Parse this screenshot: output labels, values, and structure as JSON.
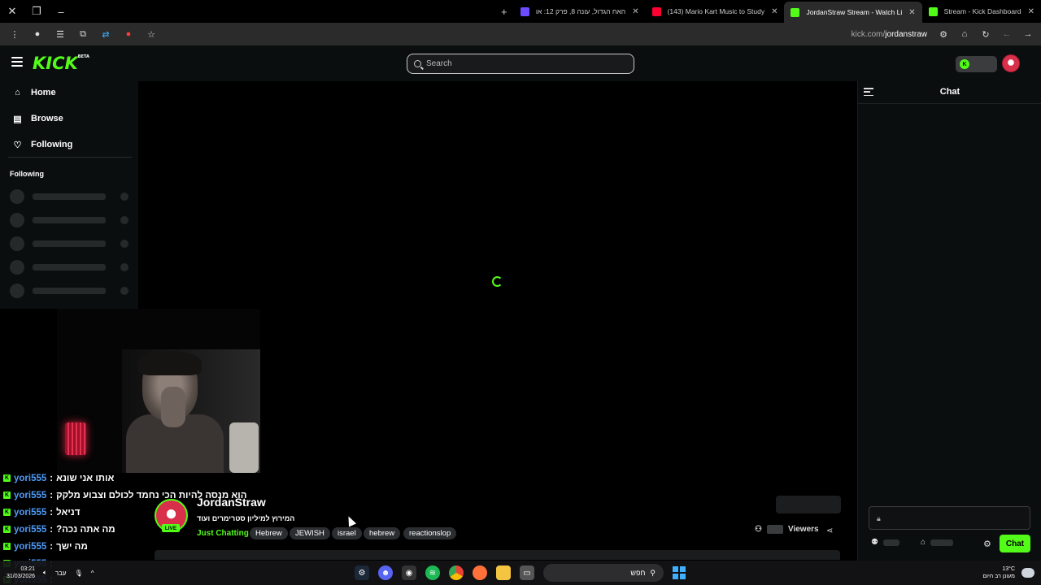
{
  "browser": {
    "tabs": [
      {
        "title": "Stream - Kick Dashboard",
        "fav_color": "#53fc18",
        "active": false
      },
      {
        "title": "JordanStraw Stream - Watch Li",
        "fav_color": "#53fc18",
        "active": true
      },
      {
        "title": "(143) Mario Kart Music to Study",
        "fav_color": "#ff0033",
        "active": false
      },
      {
        "title": "האח הגדול, עונה 8, פרק 12: או",
        "fav_color": "#6b4cff",
        "active": false
      }
    ],
    "url_host": "kick.com/",
    "url_path": "jordanstraw"
  },
  "header": {
    "logo": "KICK",
    "logo_badge": "BETA",
    "search_placeholder": "Search"
  },
  "sidebar": {
    "nav": [
      {
        "label": "Home",
        "icon": "home-icon"
      },
      {
        "label": "Browse",
        "icon": "browse-icon"
      },
      {
        "label": "Following",
        "icon": "heart-icon"
      }
    ],
    "following_heading": "Following"
  },
  "chat_overlay": [
    {
      "user": "yori555",
      "text": "אותו אני שונא"
    },
    {
      "user": "yori555",
      "text": "הוא מנסה להיות הכי נחמד לכולם וצבוע מלקק"
    },
    {
      "user": "yori555",
      "text": "דניאל"
    },
    {
      "user": "yori555",
      "text": "?מה אתה נכה"
    },
    {
      "user": "yori555",
      "text": "מה ישך"
    },
    {
      "user": "yori555",
      "text": ""
    },
    {
      "user": "yori555",
      "text": ""
    }
  ],
  "stream": {
    "channel": "JordanStraw",
    "title": "המירוץ למיליון סטרימרים ועוד",
    "live_badge": "LIVE",
    "category": "Just Chatting",
    "tags": [
      "Hebrew",
      "JEWISH",
      "israel",
      "hebrew",
      "reactionslop"
    ],
    "viewers_label": "Viewers"
  },
  "chat": {
    "title": "Chat",
    "send_label": "Chat"
  },
  "taskbar": {
    "time": "03:21",
    "date": "31/03/2026",
    "language": "עבר",
    "search_label": "חפש",
    "temperature": "13°C",
    "weather_text": "מעונן רב היום"
  },
  "colors": {
    "brand": "#53fc18",
    "username": "#4f9cf9"
  }
}
